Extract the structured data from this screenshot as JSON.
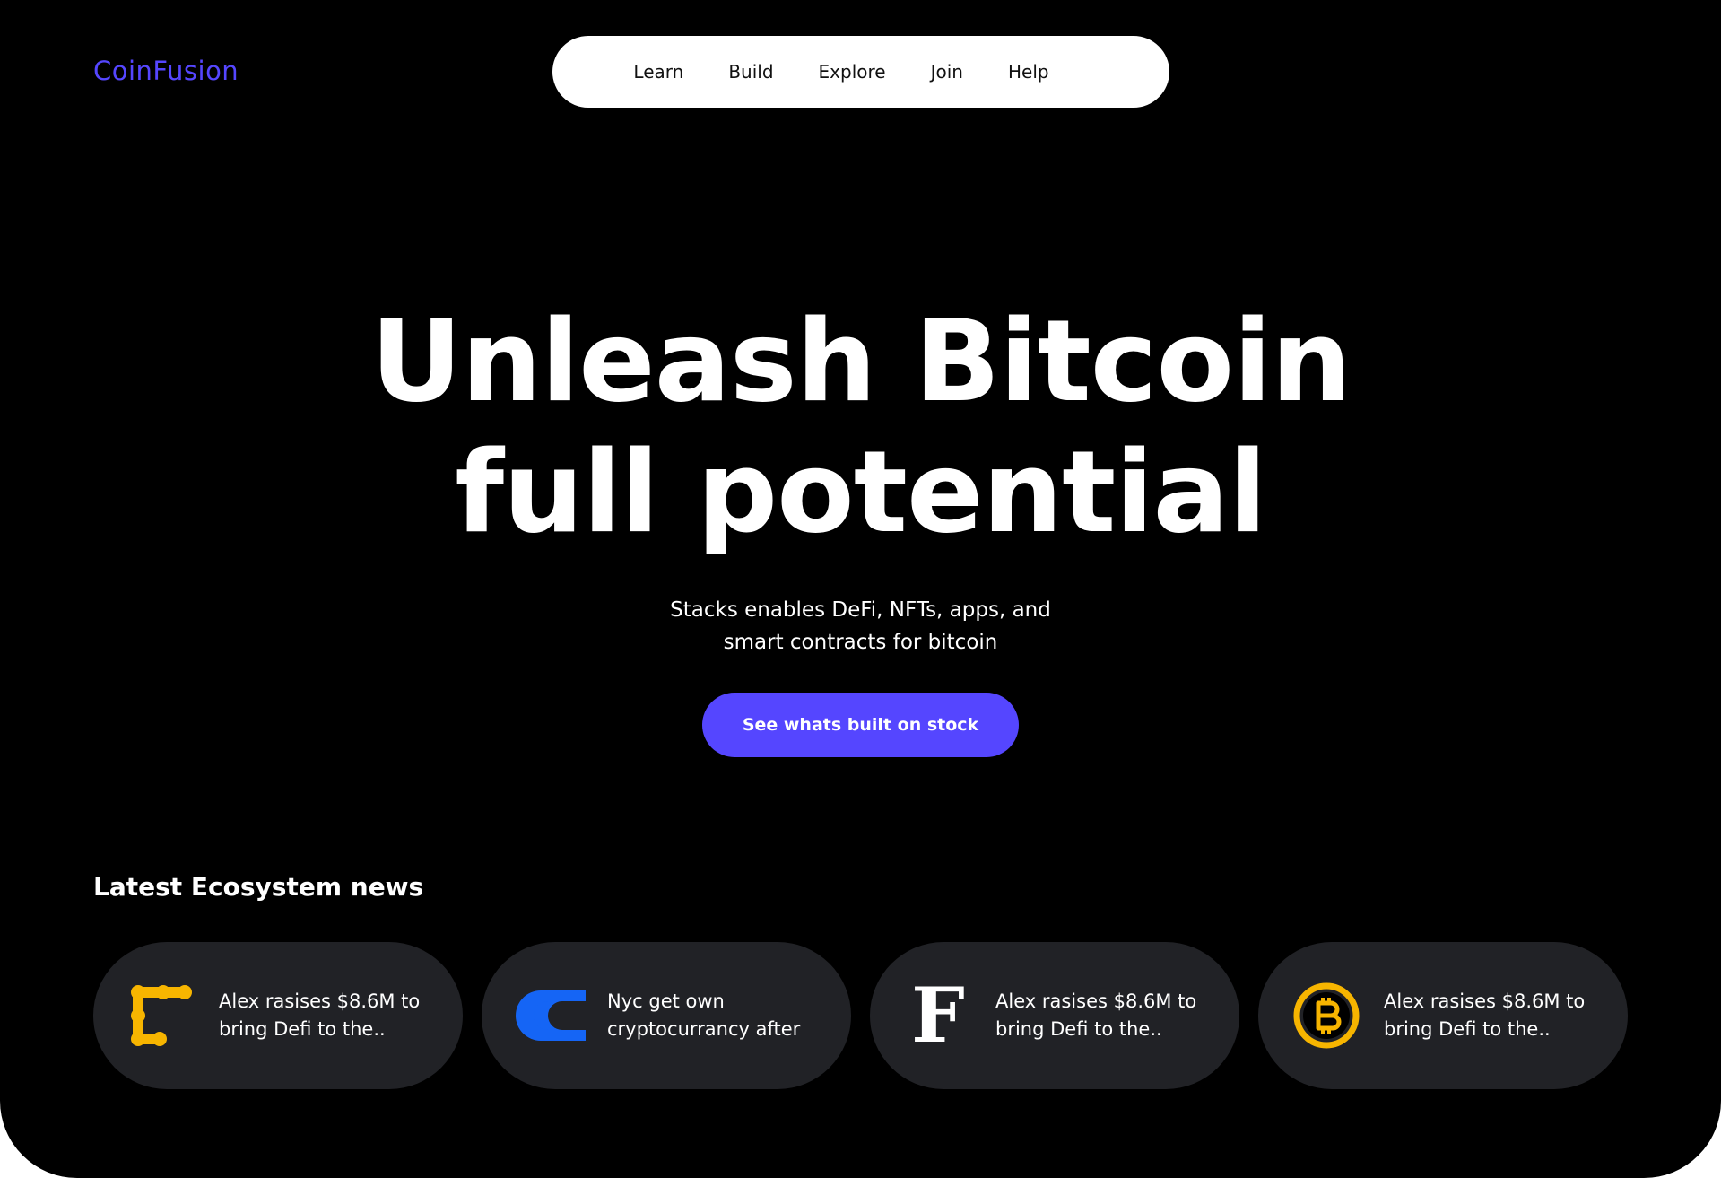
{
  "header": {
    "logo": "CoinFusion",
    "nav": [
      "Learn",
      "Build",
      "Explore",
      "Join",
      "Help"
    ]
  },
  "hero": {
    "title_line1": "Unleash Bitcoin",
    "title_line2": "full potential",
    "subtitle_line1": "Stacks enables DeFi, NFTs, apps, and",
    "subtitle_line2": "smart contracts for bitcoin",
    "cta": "See whats built on stock"
  },
  "news": {
    "title": "Latest Ecosystem news",
    "items": [
      {
        "icon": "yellow-c-dots-logo-icon",
        "line1": "Alex rasises $8.6M to",
        "line2": "bring Defi to the.."
      },
      {
        "icon": "blue-cc-logo-icon",
        "line1": "Nyc get own",
        "line2": "cryptocurrancy after"
      },
      {
        "icon": "f-serif-logo-icon",
        "line1": "Alex rasises $8.6M to",
        "line2": "bring Defi to the.."
      },
      {
        "icon": "bitcoin-icon",
        "line1": "Alex rasises $8.6M to",
        "line2": "bring Defi to the.."
      }
    ],
    "f_letter": "F"
  },
  "colors": {
    "background": "#000000",
    "accent": "#5546ff",
    "card": "#212226",
    "yellow": "#f7b500",
    "blue": "#1565f5"
  }
}
